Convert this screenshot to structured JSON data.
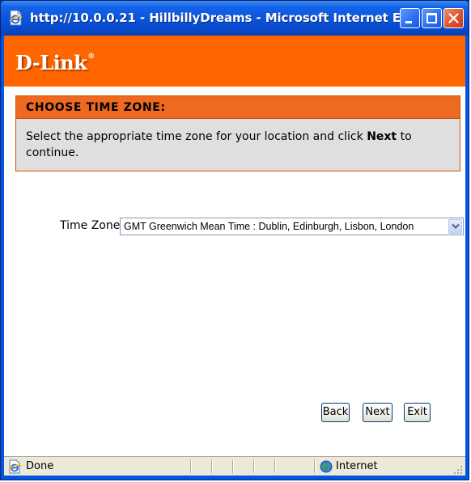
{
  "window": {
    "title": "http://10.0.0.21 - HillbillyDreams - Microsoft Internet E...",
    "title_color": "#0055e5"
  },
  "brand": {
    "logo_text": "D-Link",
    "logo_trademark": "®",
    "bar_color": "#ff6600"
  },
  "panel": {
    "title": "CHOOSE TIME ZONE:",
    "text_before": "Select the appropriate time zone for your location and click ",
    "text_bold": "Next",
    "text_after": " to continue."
  },
  "timezone": {
    "label": "Time Zone",
    "selected": "GMT Greenwich Mean Time : Dublin, Edinburgh, Lisbon, London"
  },
  "buttons": {
    "back": "Back",
    "next": "Next",
    "exit": "Exit"
  },
  "statusbar": {
    "status": "Done",
    "zone": "Internet"
  },
  "icons": {
    "title_icon": "ie-page-icon",
    "status_icon": "ie-page-icon",
    "zone_icon": "globe-icon",
    "dropdown_icon": "chevron-down-icon"
  }
}
